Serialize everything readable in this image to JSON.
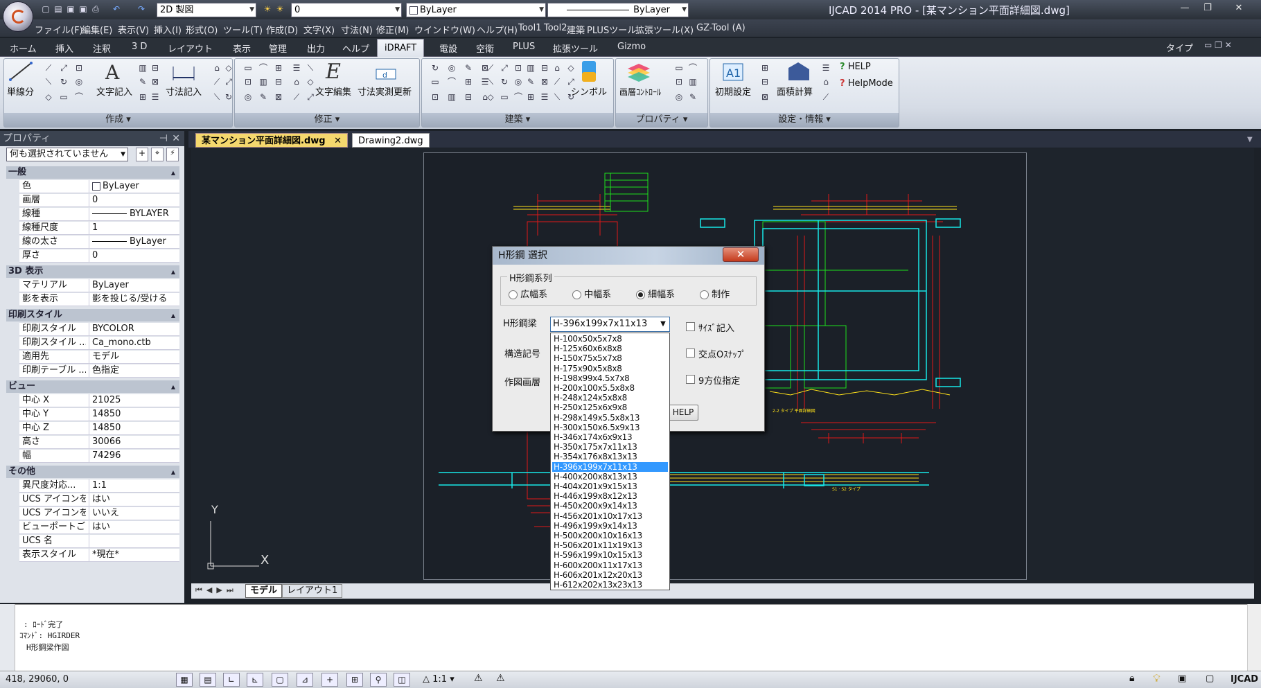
{
  "app": {
    "title": "IJCAD 2014 PRO - [某マンション平面詳細図.dwg]",
    "workspace": "2D 製図",
    "layer_combo": "0",
    "color_combo": "ByLayer",
    "linetype_combo": "ByLayer",
    "window_buttons": [
      "—",
      "❐",
      "✕"
    ]
  },
  "menu": [
    "ファイル(F)",
    "編集(E)",
    "表示(V)",
    "挿入(I)",
    "形式(O)",
    "ツール(T)",
    "作成(D)",
    "文字(X)",
    "寸法(N)",
    "修正(M)",
    "ウインドウ(W)",
    "ヘルプ(H)",
    "Tool1",
    "Tool2",
    "建築",
    "PLUSツール",
    "拡張ツール(X)",
    "GZ-Tool (A)"
  ],
  "ribbon_tabs": [
    "ホーム",
    "挿入",
    "注釈",
    "3 D",
    "レイアウト",
    "表示",
    "管理",
    "出力",
    "ヘルプ",
    "iDRAFT",
    "電設",
    "空衛",
    "PLUS",
    "拡張ツール",
    "Gizmo"
  ],
  "ribbon_active": "iDRAFT",
  "ribbon_right_label": "タイプ",
  "ribbon": {
    "groups": [
      "作成",
      "修正",
      "建築",
      "プロパティ",
      "設定・情報"
    ],
    "buttons": {
      "tanbunbun": "単線分",
      "moji_kinyu": "文字記入",
      "sunpo_kinyu": "寸法記入",
      "moji_henshu": "文字編集",
      "sunpo_jissoku": "寸法実測更新",
      "symbol": "シンボル",
      "layer_control": "画層ｺﾝﾄﾛｰﾙ",
      "shoki_settei": "初期設定",
      "menseki": "面積計算",
      "help": "HELP",
      "helpmode": "HelpMode"
    }
  },
  "properties": {
    "title": "プロパティ",
    "selection": "何も選択されていません",
    "sections": [
      {
        "name": "一般",
        "rows": [
          [
            "色",
            "ByLayer"
          ],
          [
            "画層",
            "0"
          ],
          [
            "線種",
            "BYLAYER"
          ],
          [
            "線種尺度",
            "1"
          ],
          [
            "線の太さ",
            "ByLayer"
          ],
          [
            "厚さ",
            "0"
          ]
        ]
      },
      {
        "name": "3D 表示",
        "rows": [
          [
            "マテリアル",
            "ByLayer"
          ],
          [
            "影を表示",
            "影を投じる/受ける"
          ]
        ]
      },
      {
        "name": "印刷スタイル",
        "rows": [
          [
            "印刷スタイル",
            "BYCOLOR"
          ],
          [
            "印刷スタイル ...",
            "Ca_mono.ctb"
          ],
          [
            "適用先",
            "モデル"
          ],
          [
            "印刷テーブル ...",
            "色指定"
          ]
        ]
      },
      {
        "name": "ビュー",
        "rows": [
          [
            "中心 X",
            "21025"
          ],
          [
            "中心 Y",
            "14850"
          ],
          [
            "中心 Z",
            "14850"
          ],
          [
            "高さ",
            "30066"
          ],
          [
            "幅",
            "74296"
          ]
        ]
      },
      {
        "name": "その他",
        "rows": [
          [
            "異尺度対応...",
            "1:1"
          ],
          [
            "UCS アイコンを...",
            "はい"
          ],
          [
            "UCS アイコンを...",
            "いいえ"
          ],
          [
            "ビューポートごと...",
            "はい"
          ],
          [
            "UCS 名",
            ""
          ],
          [
            "表示スタイル",
            "*現在*"
          ]
        ]
      }
    ]
  },
  "doc_tabs": [
    "某マンション平面詳細図.dwg",
    "Drawing2.dwg"
  ],
  "layout_tabs": [
    "モデル",
    "レイアウト1"
  ],
  "ucs": {
    "y": "Y",
    "x": "X"
  },
  "dialog": {
    "title": "H形鋼 選択",
    "series_label": "H形鋼系列",
    "series": [
      "広幅系",
      "中幅系",
      "細幅系",
      "制作"
    ],
    "series_selected": "細幅系",
    "beam_label": "H形鋼梁",
    "struct_label": "構造記号",
    "layer_label": "作図画層",
    "combo_value": "H-396x199x7x11x13",
    "checks": [
      "ｻｲｽﾞ記入",
      "交点Oｽﾅｯﾌﾟ",
      "9方位指定"
    ],
    "help_button": "HELP",
    "close": "✕",
    "list": [
      "H-100x50x5x7x8",
      "H-125x60x6x8x8",
      "H-150x75x5x7x8",
      "H-175x90x5x8x8",
      "H-198x99x4.5x7x8",
      "H-200x100x5.5x8x8",
      "H-248x124x5x8x8",
      "H-250x125x6x9x8",
      "H-298x149x5.5x8x13",
      "H-300x150x6.5x9x13",
      "H-346x174x6x9x13",
      "H-350x175x7x11x13",
      "H-354x176x8x13x13",
      "H-396x199x7x11x13",
      "H-400x200x8x13x13",
      "H-404x201x9x15x13",
      "H-446x199x8x12x13",
      "H-450x200x9x14x13",
      "H-456x201x10x17x13",
      "H-496x199x9x14x13",
      "H-500x200x10x16x13",
      "H-506x201x11x19x13",
      "H-596x199x10x15x13",
      "H-600x200x11x17x13",
      "H-606x201x12x20x13",
      "H-612x202x13x23x13"
    ],
    "list_selected": "H-396x199x7x11x13"
  },
  "command_lines": [
    ": ﾛｰﾄﾞ完了",
    "ｺﾏﾝﾄﾞ: HGIRDER",
    "H形鋼梁作図"
  ],
  "status": {
    "coords": "418, 29060, 0",
    "scale": "1:1",
    "right_label": "IJCAD"
  }
}
